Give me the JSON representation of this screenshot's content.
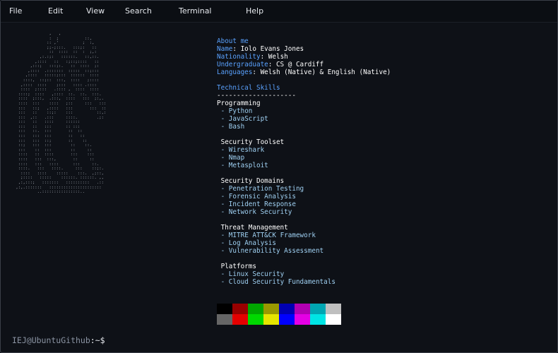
{
  "menu": [
    "File",
    "Edit",
    "View",
    "Search",
    "Terminal",
    "Help"
  ],
  "about": {
    "heading": "About me",
    "rows": [
      {
        "key": "Name",
        "value": ": Iolo Evans Jones"
      },
      {
        "key": "Nationality",
        "value": ": Welsh"
      },
      {
        "key": "Undergraduate",
        "value": ": CS @ Cardiff"
      },
      {
        "key": "Languages",
        "value": ": Welsh (Native) & English (Native)"
      }
    ]
  },
  "skills": {
    "heading": "Technical Skills",
    "divider": "--------------------",
    "groups": [
      {
        "title": "Programming",
        "items": [
          "- Python",
          "- JavaScript",
          "- Bash"
        ]
      },
      {
        "title": " Security Toolset",
        "items": [
          "- Wireshark",
          "- Nmap",
          "- Metasploit"
        ]
      },
      {
        "title": " Security Domains",
        "items": [
          "- Penetration Testing",
          "- Forensic Analysis",
          "- Incident Response",
          "- Network Security"
        ]
      },
      {
        "title": " Threat Management",
        "items": [
          "- MITRE ATT&CK Framework",
          "- Log Analysis",
          "- Vulnerability Assessment"
        ]
      },
      {
        "title": " Platforms",
        "items": [
          "- Linux Security",
          "- Cloud Security Fundamentals"
        ]
      }
    ]
  },
  "palette": {
    "top": [
      "#000000",
      "#990000",
      "#00a600",
      "#999900",
      "#0000b2",
      "#b200b2",
      "#00a6b2",
      "#bfbfbf"
    ],
    "bottom": [
      "#666666",
      "#e50000",
      "#00d900",
      "#e5e500",
      "#0000ff",
      "#e500e5",
      "#00e5e5",
      "#ffffff"
    ]
  },
  "ascii_art": "               ,   ,                    \n               :  ;           ::,       \n              :: ,'          ;  :,      \n              ;;-;:::.   :::;:   ::     \n               ::  ::::  ::  :  ;,:     \n           ,:.:;:   ::::::.   ::,::.    \n         ,::::   ::   :;::;::::   ::    \n       ,:::;   :::;:.   ::  ::::  ;:    \n      ,::::  .:::::::  :::::  ::;:::    \n     ,::::   :::::;:::  ::::::  ::::    \n    ::::,  ::;::  :::,  ::::   ;::::    \n   ,::::  ::::    ;:::   :::: .::::     \n   ::::  ;::::   .:::: ,  ::::  ::::    \n  ::::;  ::::   ,::::  ::.  ::.  :::.   \n  ::::  ;:::,  .:::,  ::::   :::  ;:,.  \n  ::::  :::    ::::   ;::     :::   ::: \n  :::   ::;   ,::::   :::       :::  :: \n  :::   ::    ::;:    :::          ::,: \n  :::  ,::   .:::     ::::.        .;:  \n  :::   ::   ::::     ::::::            \n  :::   ::   :::      :: :::            \n  :::   ::.  :::       ::  ::           \n  :::   :::  :::       ::   ::          \n  :::   :::  ::;       ::    ::         \n  ::;   :::  :::        ::    ::.       \n  :::    ::  :::        ::     ::       \n  ::::   ::  ::::       :::    :::      \n  ::::   :::  :::,       ::     ::      \n  ::::   :::   ::::      :::     ::.    \n  ::::.   :::   ::::.     :::    ::;:.  \n   ::::   ::::    :::::    :::.  ,;::,  \n   ;::::   :::::    ::::::. ::::::. ,,  \n  ,:,:::;   :::::::   ::::::::::   .::  \n ,:,.:::::::   ::::::::::::::::::::::   \n          ..::::::::::::::::..          ",
  "prompt": {
    "user": "IEJ@UbuntuGithub",
    "symbol": ":~$"
  }
}
